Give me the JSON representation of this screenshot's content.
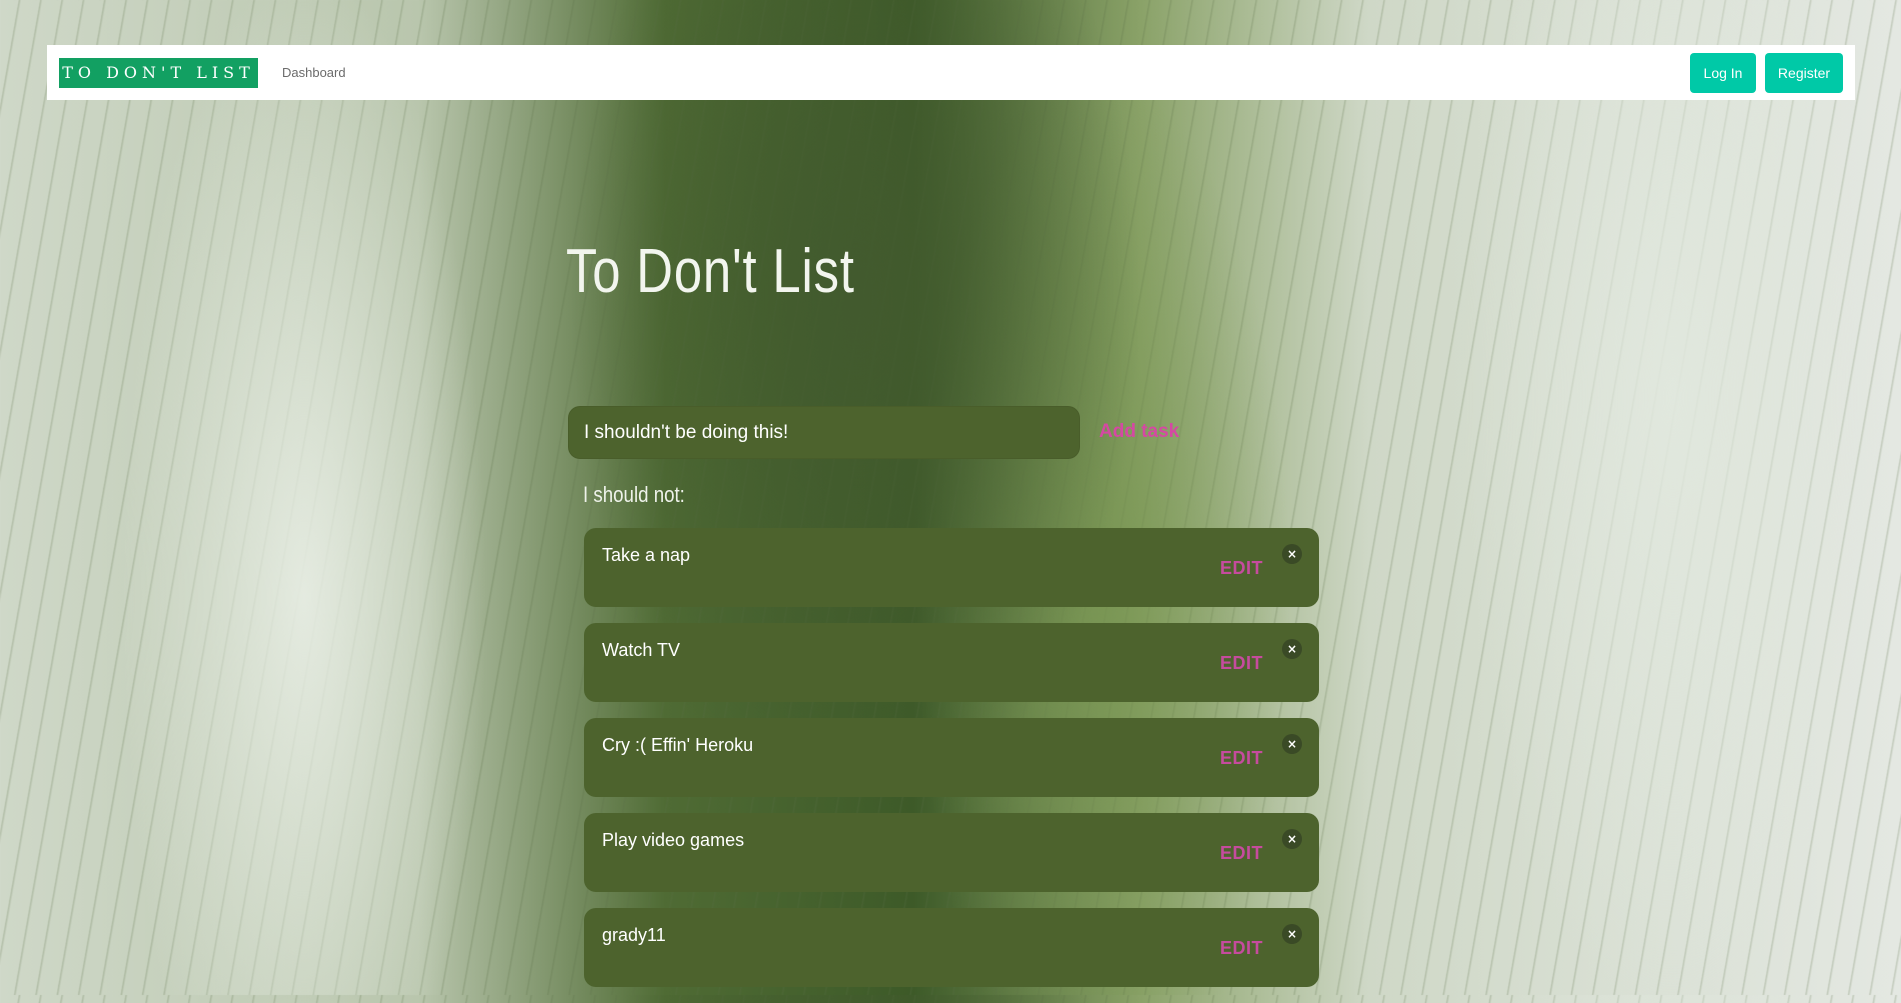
{
  "navbar": {
    "brand": "TO DON'T LIST",
    "dashboard_link": "Dashboard",
    "login_label": "Log In",
    "register_label": "Register"
  },
  "main": {
    "title": "To Don't List",
    "task_input_value": "I shouldn't be doing this!",
    "add_task_label": "Add task",
    "list_heading": "I should not:",
    "tasks": [
      {
        "text": "Take a nap",
        "edit_label": "EDIT",
        "close_icon": "×"
      },
      {
        "text": "Watch TV",
        "edit_label": "EDIT",
        "close_icon": "×"
      },
      {
        "text": "Cry :( Effin' Heroku",
        "edit_label": "EDIT",
        "close_icon": "×"
      },
      {
        "text": "Play video games",
        "edit_label": "EDIT",
        "close_icon": "×"
      },
      {
        "text": "grady11",
        "edit_label": "EDIT",
        "close_icon": "×"
      }
    ]
  },
  "colors": {
    "brand_green": "#12a062",
    "nav_button": "#00c9a7",
    "card_green": "#4d632d",
    "accent_pink": "#d548a3"
  }
}
